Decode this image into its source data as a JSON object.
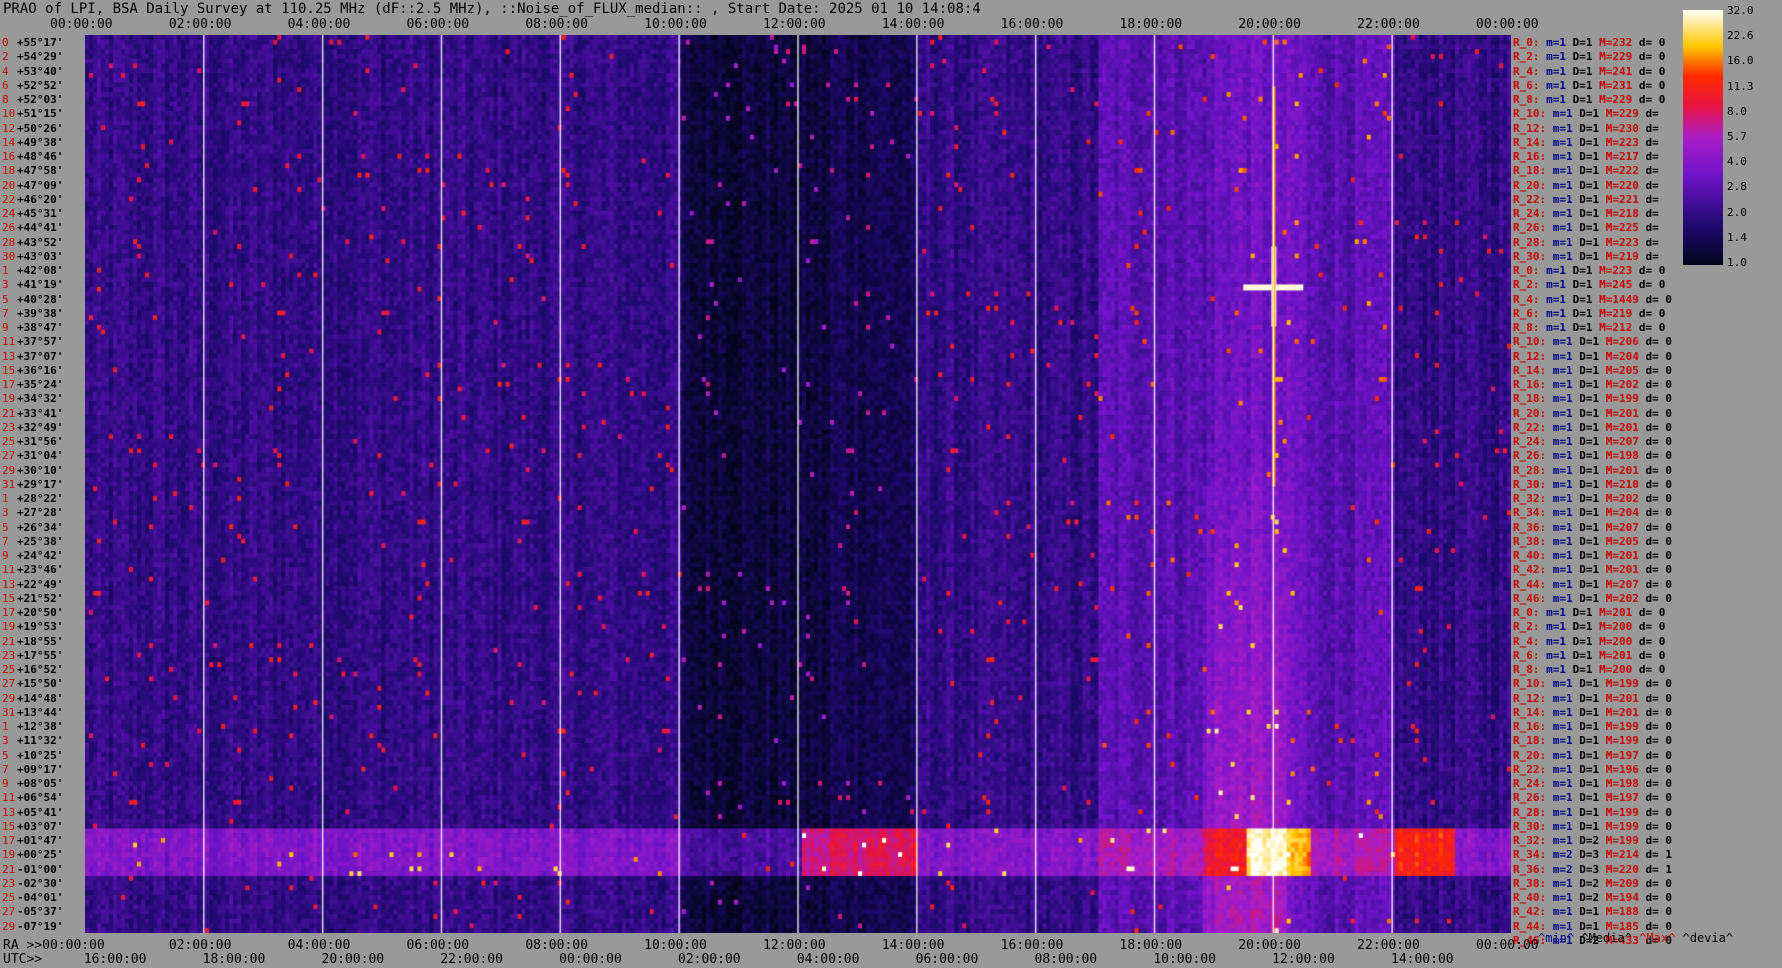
{
  "title": "PRAO of LPI, BSA Daily Survey at 110.25 MHz (dF::2.5 MHz), ::Noise_of_FLUX_median:: , Start Date: 2025 01 10 14:08:4",
  "top_ticks": [
    "00:00:00",
    "02:00:00",
    "04:00:00",
    "06:00:00",
    "08:00:00",
    "10:00:00",
    "12:00:00",
    "14:00:00",
    "16:00:00",
    "18:00:00",
    "20:00:00",
    "22:00:00",
    "00:00:00"
  ],
  "bottom_ra_label": "RA >>00:00:00",
  "bottom_ra_ticks": [
    "02:00:00",
    "04:00:00",
    "06:00:00",
    "08:00:00",
    "10:00:00",
    "12:00:00",
    "14:00:00",
    "16:00:00",
    "18:00:00",
    "20:00:00",
    "22:00:00",
    "00:00:00"
  ],
  "bottom_utc_label": "UTC>>",
  "bottom_utc_ticks": [
    "16:00:00",
    "18:00:00",
    "20:00:00",
    "22:00:00",
    "00:00:00",
    "02:00:00",
    "04:00:00",
    "06:00:00",
    "08:00:00",
    "10:00:00",
    "12:00:00",
    "14:00:00"
  ],
  "legend": {
    "min": "^min^",
    "median": "^Media^",
    "max": "^Max^",
    "dev": "^devia^"
  },
  "colorbar": {
    "ticks": [
      "32.0",
      "22.6",
      "16.0",
      "11.3",
      "8.0",
      "5.7",
      "4.0",
      "2.8",
      "2.0",
      "1.4",
      "1.0"
    ]
  },
  "chart_data": {
    "type": "heatmap",
    "title": "PRAO of LPI, BSA Daily Survey at 110.25 MHz (dF::2.5 MHz), ::Noise_of_FLUX_median:: , Start Date: 2025 01 10 14:08:4",
    "x_axis": "RA 00:00:00 – 24:00:00",
    "y_axis": "Declination +55°17' to -07°19'",
    "scale": "log",
    "range": [
      1.0,
      32.0
    ],
    "declinations": [
      "+55°17'",
      "+54°29'",
      "+53°40'",
      "+52°52'",
      "+52°03'",
      "+51°15'",
      "+50°26'",
      "+49°38'",
      "+48°46'",
      "+47°58'",
      "+47°09'",
      "+46°20'",
      "+45°31'",
      "+44°41'",
      "+43°52'",
      "+43°03'",
      "+42°08'",
      "+41°19'",
      "+40°28'",
      "+39°38'",
      "+38°47'",
      "+37°57'",
      "+37°07'",
      "+36°16'",
      "+35°24'",
      "+34°32'",
      "+33°41'",
      "+32°49'",
      "+31°56'",
      "+31°04'",
      "+30°10'",
      "+29°17'",
      "+28°22'",
      "+27°28'",
      "+26°34'",
      "+25°38'",
      "+24°42'",
      "+23°46'",
      "+22°49'",
      "+21°52'",
      "+20°50'",
      "+19°53'",
      "+18°55'",
      "+17°55'",
      "+16°52'",
      "+15°50'",
      "+14°48'",
      "+13°44'",
      "+12°38'",
      "+11°32'",
      "+10°25'",
      "+09°17'",
      "+08°05'",
      "+06°54'",
      "+05°41'",
      "+03°07'",
      "+01°47'",
      "+00°25'",
      "-01°00'",
      "-02°30'",
      "-04°01'",
      "-05°37'",
      "-07°19'"
    ],
    "row_index": [
      "0",
      "2",
      "4",
      "6",
      "8",
      "10",
      "12",
      "14",
      "16",
      "18",
      "20",
      "22",
      "24",
      "26",
      "28",
      "30",
      "1",
      "3",
      "5",
      "7",
      "9",
      "11",
      "13",
      "15",
      "17",
      "19",
      "21",
      "23",
      "25",
      "27",
      "29",
      "31",
      "1",
      "3",
      "5",
      "7",
      "9",
      "11",
      "13",
      "15",
      "17",
      "19",
      "21",
      "23",
      "25",
      "27",
      "29",
      "31",
      "1",
      "3",
      "5",
      "7",
      "9",
      "11",
      "13",
      "15",
      "17",
      "19",
      "21",
      "23",
      "25",
      "27",
      "29"
    ],
    "stats": [
      {
        "R": "R_0:",
        "m": "m=1",
        "D": "D=1",
        "M": "M=232",
        "d": "d= 0"
      },
      {
        "R": "R_2:",
        "m": "m=1",
        "D": "D=1",
        "M": "M=229",
        "d": "d= 0"
      },
      {
        "R": "R_4:",
        "m": "m=1",
        "D": "D=1",
        "M": "M=241",
        "d": "d= 0"
      },
      {
        "R": "R_6:",
        "m": "m=1",
        "D": "D=1",
        "M": "M=231",
        "d": "d= 0"
      },
      {
        "R": "R_8:",
        "m": "m=1",
        "D": "D=1",
        "M": "M=229",
        "d": "d= 0"
      },
      {
        "R": "R_10:",
        "m": "m=1",
        "D": "D=1",
        "M": "M=229",
        "d": "d="
      },
      {
        "R": "R_12:",
        "m": "m=1",
        "D": "D=1",
        "M": "M=230",
        "d": "d="
      },
      {
        "R": "R_14:",
        "m": "m=1",
        "D": "D=1",
        "M": "M=223",
        "d": "d="
      },
      {
        "R": "R_16:",
        "m": "m=1",
        "D": "D=1",
        "M": "M=217",
        "d": "d="
      },
      {
        "R": "R_18:",
        "m": "m=1",
        "D": "D=1",
        "M": "M=222",
        "d": "d="
      },
      {
        "R": "R_20:",
        "m": "m=1",
        "D": "D=1",
        "M": "M=220",
        "d": "d="
      },
      {
        "R": "R_22:",
        "m": "m=1",
        "D": "D=1",
        "M": "M=221",
        "d": "d="
      },
      {
        "R": "R_24:",
        "m": "m=1",
        "D": "D=1",
        "M": "M=218",
        "d": "d="
      },
      {
        "R": "R_26:",
        "m": "m=1",
        "D": "D=1",
        "M": "M=225",
        "d": "d="
      },
      {
        "R": "R_28:",
        "m": "m=1",
        "D": "D=1",
        "M": "M=223",
        "d": "d="
      },
      {
        "R": "R_30:",
        "m": "m=1",
        "D": "D=1",
        "M": "M=219",
        "d": "d="
      },
      {
        "R": "R_0:",
        "m": "m=1",
        "D": "D=1",
        "M": "M=223",
        "d": "d= 0"
      },
      {
        "R": "R_2:",
        "m": "m=1",
        "D": "D=1",
        "M": "M=245",
        "d": "d= 0"
      },
      {
        "R": "R_4:",
        "m": "m=1",
        "D": "D=1",
        "M": "M=1449",
        "d": "d= 0"
      },
      {
        "R": "R_6:",
        "m": "m=1",
        "D": "D=1",
        "M": "M=219",
        "d": "d= 0"
      },
      {
        "R": "R_8:",
        "m": "m=1",
        "D": "D=1",
        "M": "M=212",
        "d": "d= 0"
      },
      {
        "R": "R_10:",
        "m": "m=1",
        "D": "D=1",
        "M": "M=206",
        "d": "d= 0"
      },
      {
        "R": "R_12:",
        "m": "m=1",
        "D": "D=1",
        "M": "M=204",
        "d": "d= 0"
      },
      {
        "R": "R_14:",
        "m": "m=1",
        "D": "D=1",
        "M": "M=205",
        "d": "d= 0"
      },
      {
        "R": "R_16:",
        "m": "m=1",
        "D": "D=1",
        "M": "M=202",
        "d": "d= 0"
      },
      {
        "R": "R_18:",
        "m": "m=1",
        "D": "D=1",
        "M": "M=199",
        "d": "d= 0"
      },
      {
        "R": "R_20:",
        "m": "m=1",
        "D": "D=1",
        "M": "M=201",
        "d": "d= 0"
      },
      {
        "R": "R_22:",
        "m": "m=1",
        "D": "D=1",
        "M": "M=201",
        "d": "d= 0"
      },
      {
        "R": "R_24:",
        "m": "m=1",
        "D": "D=1",
        "M": "M=207",
        "d": "d= 0"
      },
      {
        "R": "R_26:",
        "m": "m=1",
        "D": "D=1",
        "M": "M=198",
        "d": "d= 0"
      },
      {
        "R": "R_28:",
        "m": "m=1",
        "D": "D=1",
        "M": "M=201",
        "d": "d= 0"
      },
      {
        "R": "R_30:",
        "m": "m=1",
        "D": "D=1",
        "M": "M=210",
        "d": "d= 0"
      },
      {
        "R": "R_32:",
        "m": "m=1",
        "D": "D=1",
        "M": "M=202",
        "d": "d= 0"
      },
      {
        "R": "R_34:",
        "m": "m=1",
        "D": "D=1",
        "M": "M=204",
        "d": "d= 0"
      },
      {
        "R": "R_36:",
        "m": "m=1",
        "D": "D=1",
        "M": "M=207",
        "d": "d= 0"
      },
      {
        "R": "R_38:",
        "m": "m=1",
        "D": "D=1",
        "M": "M=205",
        "d": "d= 0"
      },
      {
        "R": "R_40:",
        "m": "m=1",
        "D": "D=1",
        "M": "M=201",
        "d": "d= 0"
      },
      {
        "R": "R_42:",
        "m": "m=1",
        "D": "D=1",
        "M": "M=201",
        "d": "d= 0"
      },
      {
        "R": "R_44:",
        "m": "m=1",
        "D": "D=1",
        "M": "M=207",
        "d": "d= 0"
      },
      {
        "R": "R_46:",
        "m": "m=1",
        "D": "D=1",
        "M": "M=202",
        "d": "d= 0"
      },
      {
        "R": "R_0:",
        "m": "m=1",
        "D": "D=1",
        "M": "M=201",
        "d": "d= 0"
      },
      {
        "R": "R_2:",
        "m": "m=1",
        "D": "D=1",
        "M": "M=200",
        "d": "d= 0"
      },
      {
        "R": "R_4:",
        "m": "m=1",
        "D": "D=1",
        "M": "M=200",
        "d": "d= 0"
      },
      {
        "R": "R_6:",
        "m": "m=1",
        "D": "D=1",
        "M": "M=201",
        "d": "d= 0"
      },
      {
        "R": "R_8:",
        "m": "m=1",
        "D": "D=1",
        "M": "M=200",
        "d": "d= 0"
      },
      {
        "R": "R_10:",
        "m": "m=1",
        "D": "D=1",
        "M": "M=199",
        "d": "d= 0"
      },
      {
        "R": "R_12:",
        "m": "m=1",
        "D": "D=1",
        "M": "M=201",
        "d": "d= 0"
      },
      {
        "R": "R_14:",
        "m": "m=1",
        "D": "D=1",
        "M": "M=201",
        "d": "d= 0"
      },
      {
        "R": "R_16:",
        "m": "m=1",
        "D": "D=1",
        "M": "M=199",
        "d": "d= 0"
      },
      {
        "R": "R_18:",
        "m": "m=1",
        "D": "D=1",
        "M": "M=199",
        "d": "d= 0"
      },
      {
        "R": "R_20:",
        "m": "m=1",
        "D": "D=1",
        "M": "M=197",
        "d": "d= 0"
      },
      {
        "R": "R_22:",
        "m": "m=1",
        "D": "D=1",
        "M": "M=196",
        "d": "d= 0"
      },
      {
        "R": "R_24:",
        "m": "m=1",
        "D": "D=1",
        "M": "M=198",
        "d": "d= 0"
      },
      {
        "R": "R_26:",
        "m": "m=1",
        "D": "D=1",
        "M": "M=197",
        "d": "d= 0"
      },
      {
        "R": "R_28:",
        "m": "m=1",
        "D": "D=1",
        "M": "M=199",
        "d": "d= 0"
      },
      {
        "R": "R_30:",
        "m": "m=1",
        "D": "D=1",
        "M": "M=199",
        "d": "d= 0"
      },
      {
        "R": "R_32:",
        "m": "m=1",
        "D": "D=2",
        "M": "M=199",
        "d": "d= 0"
      },
      {
        "R": "R_34:",
        "m": "m=2",
        "D": "D=3",
        "M": "M=214",
        "d": "d= 1"
      },
      {
        "R": "R_36:",
        "m": "m=2",
        "D": "D=3",
        "M": "M=220",
        "d": "d= 1"
      },
      {
        "R": "R_38:",
        "m": "m=1",
        "D": "D=2",
        "M": "M=209",
        "d": "d= 0"
      },
      {
        "R": "R_40:",
        "m": "m=1",
        "D": "D=2",
        "M": "M=194",
        "d": "d= 0"
      },
      {
        "R": "R_42:",
        "m": "m=1",
        "D": "D=1",
        "M": "M=188",
        "d": "d= 0"
      },
      {
        "R": "R_44:",
        "m": "m=1",
        "D": "D=1",
        "M": "M=185",
        "d": "d= 0"
      },
      {
        "R": "R_46:",
        "m": "m=1",
        "D": "D=2",
        "M": "M=433",
        "d": "d= 0"
      }
    ]
  }
}
